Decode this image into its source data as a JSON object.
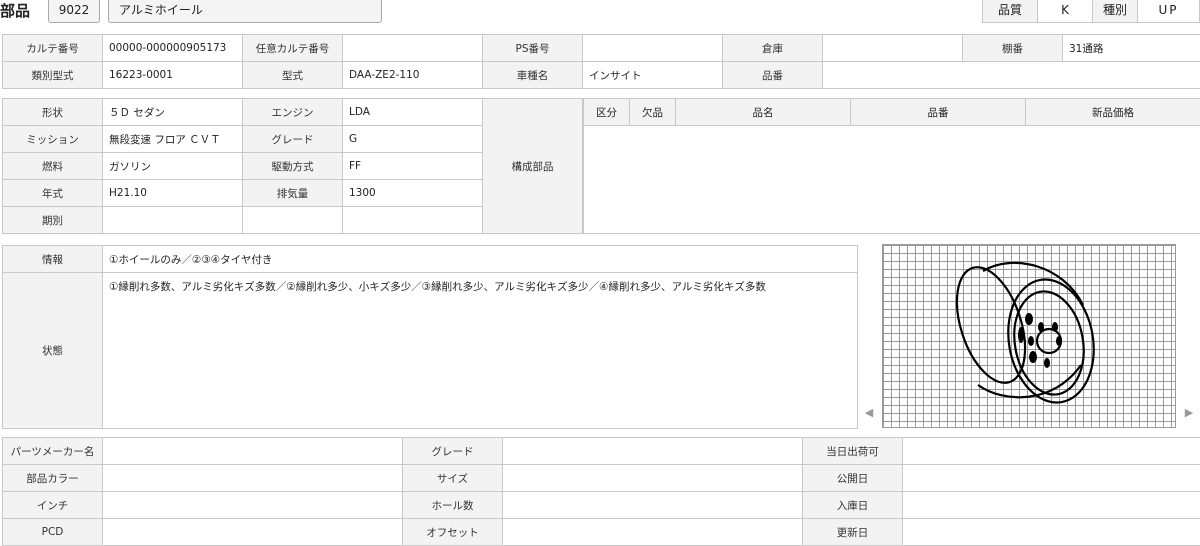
{
  "header": {
    "title": "部品",
    "code": "9022",
    "part_name": "アルミホイール",
    "quality_label": "品質",
    "quality_value": "K",
    "type_label": "種別",
    "type_value": "UP"
  },
  "top": {
    "karte_no_label": "カルテ番号",
    "karte_no": "00000-000000905173",
    "opt_karte_label": "任意カルテ番号",
    "opt_karte": "",
    "ps_label": "PS番号",
    "ps": "",
    "warehouse_label": "倉庫",
    "warehouse": "",
    "shelf_label": "棚番",
    "shelf": "31通路",
    "class_label": "類別型式",
    "class_value": "16223-0001",
    "model_label": "型式",
    "model": "DAA-ZE2-110",
    "car_label": "車種名",
    "car": "インサイト",
    "partno_label": "品番",
    "partno": ""
  },
  "spec": {
    "shape_label": "形状",
    "shape": "５Ｄ セダン",
    "engine_label": "エンジン",
    "engine": "LDA",
    "mission_label": "ミッション",
    "mission": "無段変速 フロア ＣＶＴ",
    "grade_label": "グレード",
    "grade": "G",
    "fuel_label": "燃料",
    "fuel": "ガソリン",
    "drive_label": "駆動方式",
    "drive": "FF",
    "year_label": "年式",
    "year": "H21.10",
    "displacement_label": "排気量",
    "displacement": "1300",
    "period_label": "期別",
    "period": "",
    "component_label": "構成部品"
  },
  "parts_table": {
    "headers": [
      "区分",
      "欠品",
      "品名",
      "品番",
      "新品価格"
    ]
  },
  "info": {
    "info_label": "情報",
    "info": "①ホイールのみ／②③④タイヤ付き",
    "status_label": "状態",
    "status": "①縁削れ多数、アルミ劣化キズ多数／②縁削れ多少、小キズ多少／③縁削れ多少、アルミ劣化キズ多少／④縁削れ多少、アルミ劣化キズ多数"
  },
  "bottom": {
    "maker_label": "パーツメーカー名",
    "maker": "",
    "grade_label": "グレード",
    "grade": "",
    "ship_label": "当日出荷可",
    "ship": "",
    "color_label": "部品カラー",
    "color": "",
    "size_label": "サイズ",
    "size": "",
    "public_label": "公開日",
    "public": "",
    "inch_label": "インチ",
    "inch": "",
    "holes_label": "ホール数",
    "holes": "",
    "arrival_label": "入庫日",
    "arrival": "",
    "pcd_label": "PCD",
    "pcd": "",
    "offset_label": "オフセット",
    "offset": "",
    "updated_label": "更新日",
    "updated": ""
  },
  "viewer": {
    "image_icon": "wheel-drawing",
    "prev_icon": "chevron-left-icon",
    "next_icon": "chevron-right-icon"
  }
}
